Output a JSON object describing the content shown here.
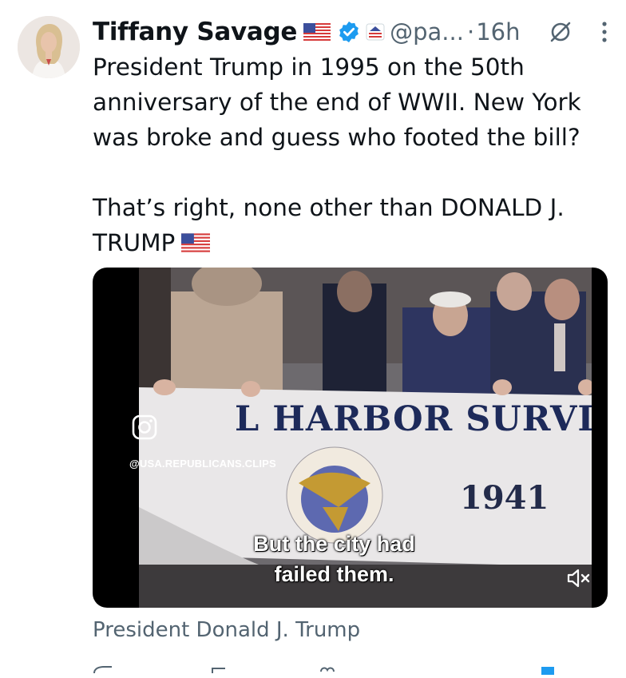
{
  "author": {
    "name": "Tiffany Savage",
    "handle": "@pa...",
    "separator": "·",
    "time": "16h"
  },
  "tweet": {
    "lines_para1": [
      "President Trump in 1995 on the 50th",
      "anniversary of the end of WWII.  New York",
      "was broke and guess who footed the bill?"
    ],
    "para2_line1": "That’s right, none other than DONALD J.",
    "para2_line2": "TRUMP"
  },
  "media": {
    "banner_text": "L HARBOR SURVIVORS",
    "banner_year": "1941",
    "watermark": "@USA.REPUBLICANS.CLIPS",
    "caption_line1": "But the city had",
    "caption_line2": "failed them."
  },
  "source_label": "President Donald J. Trump",
  "icons": {
    "flag": "us-flag-icon",
    "verified": "verified-badge-icon",
    "affiliation": "affiliation-icon",
    "grok": "grok-icon",
    "more": "more-icon",
    "mute": "muted-speaker-icon",
    "instagram": "instagram-icon"
  },
  "colors": {
    "verified_blue": "#1d9bf0",
    "secondary_text": "#536471"
  }
}
